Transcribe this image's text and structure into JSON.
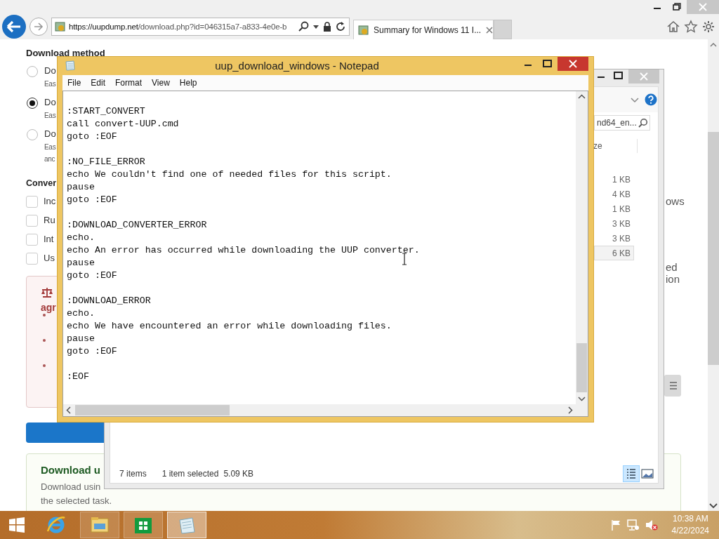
{
  "browser": {
    "url_host": "https://uupdump.net",
    "url_path": "/download.php?id=046315a7-a833-4e0e-b",
    "tabs": [
      {
        "title": "Summary for Windows 11 I...",
        "selected": true
      }
    ]
  },
  "page": {
    "method_heading": "Download method",
    "methods": [
      {
        "label": "Do",
        "hints": [
          "Eas"
        ],
        "selected": false
      },
      {
        "label": "Do",
        "hints": [
          "Eas"
        ],
        "selected": true
      },
      {
        "label": "Do",
        "hints": [
          "Eas",
          "anc"
        ],
        "selected": false
      }
    ],
    "conversion_heading": "Conver",
    "options": [
      {
        "label": "Inc",
        "checked": false
      },
      {
        "label": "Ru",
        "checked": false
      },
      {
        "label": "Int",
        "checked": false
      },
      {
        "label": "Us",
        "checked": false
      }
    ],
    "notice": {
      "title": "agr",
      "items": [
        {
          "kind": "bullet"
        },
        {
          "kind": "bullet"
        },
        {
          "kind": "bullet"
        }
      ]
    },
    "side_texts": [
      {
        "lines": [
          "ows"
        ]
      },
      {
        "lines": [
          "ed",
          "ion"
        ]
      }
    ],
    "card": {
      "title": "Download u",
      "lines": [
        "Download usin",
        "the selected task."
      ]
    }
  },
  "explorer": {
    "search": "nd64_en...",
    "column": "ze",
    "rows": [
      {
        "size": "1 KB",
        "selected": false
      },
      {
        "size": "4 KB",
        "selected": false
      },
      {
        "size": "1 KB",
        "selected": false
      },
      {
        "size": "3 KB",
        "selected": false
      },
      {
        "size": "3 KB",
        "selected": false
      },
      {
        "size": "6 KB",
        "selected": true
      }
    ],
    "status": {
      "count": "7 items",
      "selection": "1 item selected",
      "size": "5.09 KB"
    },
    "views": [
      {
        "kind": "details",
        "selected": true
      },
      {
        "kind": "thumbnails",
        "selected": false
      }
    ]
  },
  "notepad": {
    "title": "uup_download_windows - Notepad",
    "menu": [
      "File",
      "Edit",
      "Format",
      "View",
      "Help"
    ],
    "blocks": [
      [
        ":START_CONVERT",
        "call convert-UUP.cmd",
        "goto :EOF"
      ],
      [
        ":NO_FILE_ERROR",
        "echo We couldn't find one of needed files for this script.",
        "pause",
        "goto :EOF"
      ],
      [
        ":DOWNLOAD_CONVERTER_ERROR",
        "echo.",
        "echo An error has occurred while downloading the UUP converter.",
        "pause",
        "goto :EOF"
      ],
      [
        ":DOWNLOAD_ERROR",
        "echo.",
        "echo We have encountered an error while downloading files.",
        "pause",
        "goto :EOF"
      ],
      [
        ":EOF"
      ]
    ]
  },
  "taskbar": {
    "apps": [
      {
        "kind": "ie",
        "active": false
      },
      {
        "kind": "explorer",
        "active": false
      },
      {
        "kind": "store",
        "active": false
      },
      {
        "kind": "notepad",
        "active": true
      }
    ],
    "time": "10:38 AM",
    "date": "4/22/2024"
  }
}
